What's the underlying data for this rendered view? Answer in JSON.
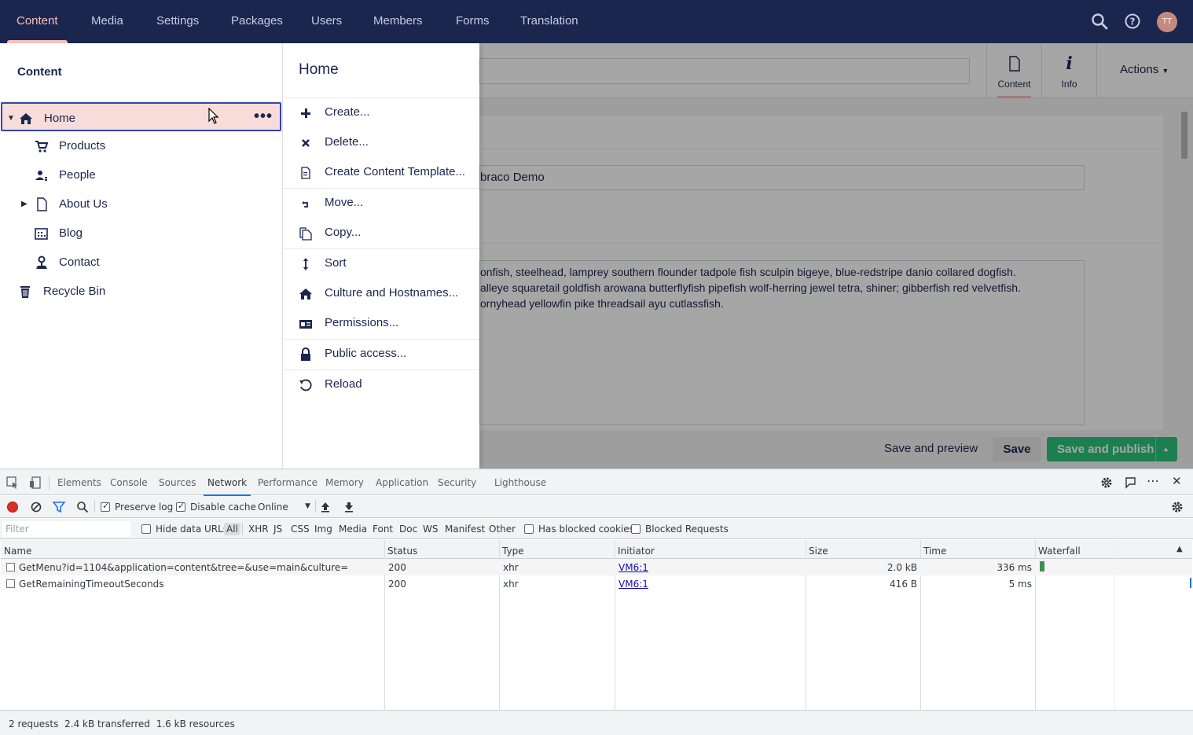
{
  "topnav": {
    "tabs": [
      {
        "label": "Content",
        "active": true
      },
      {
        "label": "Media"
      },
      {
        "label": "Settings"
      },
      {
        "label": "Packages"
      },
      {
        "label": "Users"
      },
      {
        "label": "Members"
      },
      {
        "label": "Forms"
      },
      {
        "label": "Translation"
      }
    ],
    "icons": [
      "search-icon",
      "help-icon"
    ],
    "avatar_initials": "TT"
  },
  "tree": {
    "title": "Content",
    "items": [
      {
        "label": "Home",
        "icon": "home-icon",
        "selected": true,
        "expanded": true
      },
      {
        "label": "Products",
        "icon": "shopping-cart-icon"
      },
      {
        "label": "People",
        "icon": "people-icon"
      },
      {
        "label": "About Us",
        "icon": "document-icon",
        "collapsed": true
      },
      {
        "label": "Blog",
        "icon": "calendar-icon"
      },
      {
        "label": "Contact",
        "icon": "map-pin-icon"
      },
      {
        "label": "Recycle Bin",
        "icon": "trash-icon"
      }
    ]
  },
  "menu": {
    "title": "Home",
    "items": [
      {
        "label": "Create...",
        "icon": "plus-icon"
      },
      {
        "label": "Delete...",
        "icon": "x-icon"
      },
      {
        "label": "Create Content Template...",
        "icon": "blueprint-icon"
      },
      {
        "label": "Move...",
        "icon": "move-icon"
      },
      {
        "label": "Copy...",
        "icon": "copy-icon"
      },
      {
        "label": "Sort",
        "icon": "sort-icon"
      },
      {
        "label": "Culture and Hostnames...",
        "icon": "home-icon"
      },
      {
        "label": "Permissions...",
        "icon": "id-card-icon"
      },
      {
        "label": "Public access...",
        "icon": "lock-icon"
      },
      {
        "label": "Reload",
        "icon": "reload-icon"
      }
    ]
  },
  "editor": {
    "app_tabs": [
      {
        "label": "Content",
        "icon": "document-icon",
        "active": true
      },
      {
        "label": "Info",
        "icon": "info-icon"
      }
    ],
    "actions_label": "Actions",
    "site_name_value": "braco Demo",
    "body_lines": [
      "onfish, steelhead, lamprey southern flounder tadpole fish sculpin bigeye, blue-redstripe danio collared dogfish.",
      "alleye squaretail goldfish arowana butterflyfish pipefish wolf-herring jewel tetra, shiner; gibberfish red velvetfish.",
      "ornyhead yellowfin pike threadsail ayu cutlassfish."
    ],
    "buttons": {
      "preview": "Save and preview",
      "save": "Save",
      "publish": "Save and publish"
    }
  },
  "devtools": {
    "tabs": [
      "Elements",
      "Console",
      "Sources",
      "Network",
      "Performance",
      "Memory",
      "Application",
      "Security",
      "Lighthouse"
    ],
    "active_tab": "Network",
    "toolbar": {
      "preserve_log": "Preserve log",
      "disable_cache": "Disable cache",
      "throttle": "Online"
    },
    "filter": {
      "placeholder": "Filter",
      "hide_data_urls": "Hide data URLs",
      "types": [
        "All",
        "XHR",
        "JS",
        "CSS",
        "Img",
        "Media",
        "Font",
        "Doc",
        "WS",
        "Manifest",
        "Other"
      ],
      "has_blocked_cookies": "Has blocked cookies",
      "blocked_requests": "Blocked Requests"
    },
    "columns": [
      "Name",
      "Status",
      "Type",
      "Initiator",
      "Size",
      "Time",
      "Waterfall"
    ],
    "rows": [
      {
        "name": "GetMenu?id=1104&application=content&tree=&use=main&culture=",
        "status": "200",
        "type": "xhr",
        "initiator": "VM6:1",
        "size": "2.0 kB",
        "time": "336 ms"
      },
      {
        "name": "GetRemainingTimeoutSeconds",
        "status": "200",
        "type": "xhr",
        "initiator": "VM6:1",
        "size": "416 B",
        "time": "5 ms"
      }
    ],
    "summary": {
      "requests": "2 requests",
      "transferred": "2.4 kB transferred",
      "resources": "1.6 kB resources"
    }
  },
  "colors": {
    "nav_bg": "#1b264f",
    "accent_pink": "#f5c1bc",
    "publish_green": "#2bc37c",
    "devtools_blue": "#1a73e8"
  }
}
